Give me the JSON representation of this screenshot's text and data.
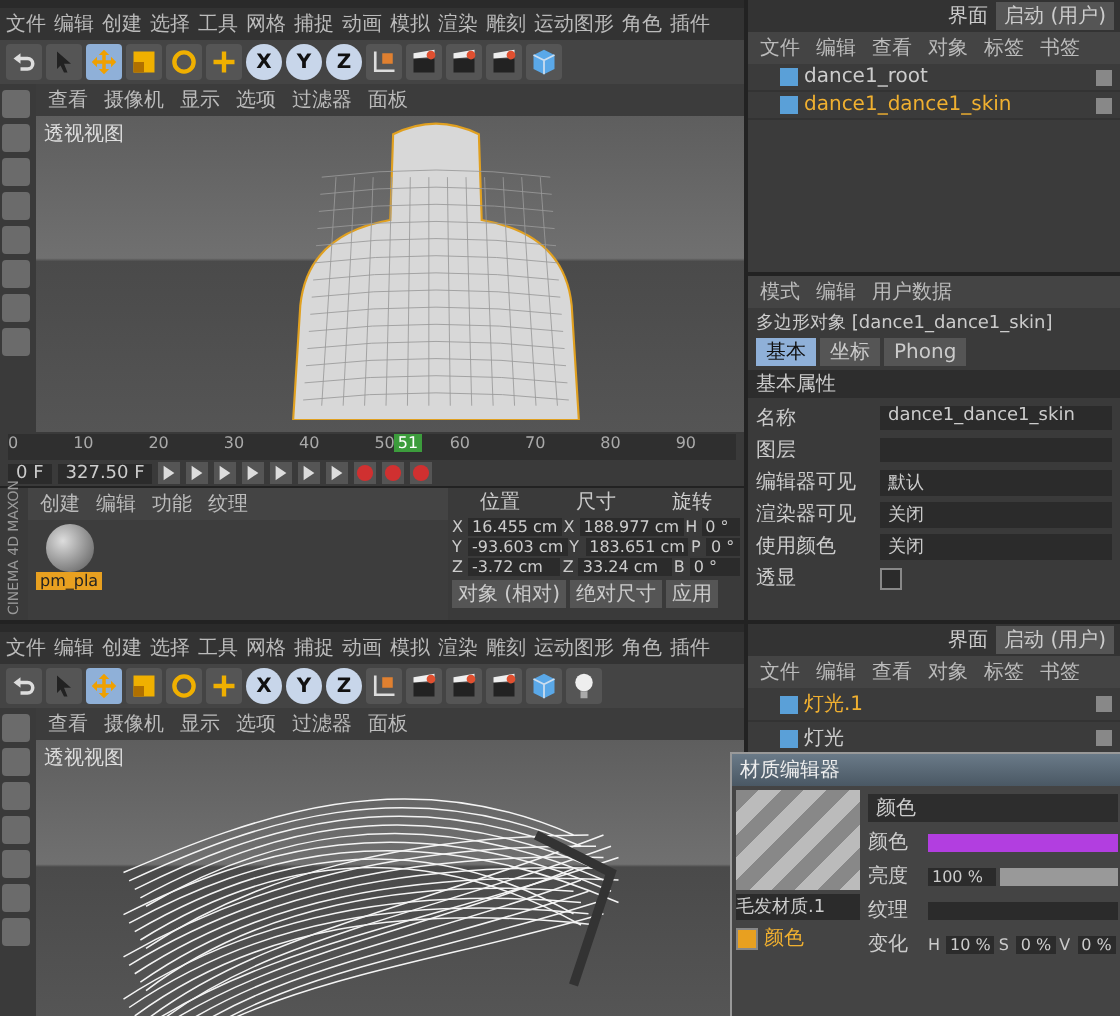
{
  "top_screen": {
    "layout": {
      "label": "界面",
      "value": "启动 (用户)"
    },
    "menu_bar": [
      "文件",
      "编辑",
      "创建",
      "选择",
      "工具",
      "网格",
      "捕捉",
      "动画",
      "模拟",
      "渲染",
      "雕刻",
      "运动图形",
      "角色",
      "插件"
    ],
    "tools": [
      {
        "kind": "undo",
        "selected": false
      },
      {
        "kind": "select",
        "selected": false
      },
      {
        "kind": "move",
        "selected": true
      },
      {
        "kind": "scale",
        "selected": false
      },
      {
        "kind": "rotate",
        "selected": false
      },
      {
        "kind": "add",
        "selected": false
      },
      {
        "kind": "axis",
        "label": "X",
        "selected": true
      },
      {
        "kind": "axis",
        "label": "Y",
        "selected": true
      },
      {
        "kind": "axis",
        "label": "Z",
        "selected": true
      },
      {
        "kind": "coord",
        "selected": false
      },
      {
        "kind": "render",
        "selected": false
      },
      {
        "kind": "render",
        "selected": false
      },
      {
        "kind": "render",
        "selected": false
      },
      {
        "kind": "cube",
        "selected": false
      }
    ],
    "viewport": {
      "menu": [
        "查看",
        "摄像机",
        "显示",
        "选项",
        "过滤器",
        "面板"
      ],
      "label": "透视视图"
    },
    "timeline": {
      "ticks": [
        "0",
        "10",
        "20",
        "30",
        "40",
        "50",
        "60",
        "70",
        "80",
        "90"
      ],
      "current_frame": "51",
      "level": 0.53,
      "start_field": "0 F",
      "end_field": "327.50 F"
    },
    "materials": {
      "menu": [
        "创建",
        "编辑",
        "功能",
        "纹理"
      ],
      "items": [
        {
          "name": "pm_pla",
          "selected": true
        }
      ]
    },
    "brand": {
      "company": "MAXON",
      "product": "CINEMA 4D"
    },
    "coordinates": {
      "headers": [
        "位置",
        "尺寸",
        "旋转"
      ],
      "rows": [
        {
          "axis": "X",
          "position": "16.455 cm",
          "size_axis": "X",
          "size": "188.977 cm",
          "rotation_axis": "H",
          "rotation": "0 °"
        },
        {
          "axis": "Y",
          "position": "-93.603 cm",
          "size_axis": "Y",
          "size": "183.651 cm",
          "rotation_axis": "P",
          "rotation": "0 °"
        },
        {
          "axis": "Z",
          "position": "-3.72 cm",
          "size_axis": "Z",
          "size": "33.24 cm",
          "rotation_axis": "B",
          "rotation": "0 °"
        }
      ],
      "buttons": [
        "对象 (相对)",
        "绝对尺寸",
        "应用"
      ]
    },
    "object_manager": {
      "menu": [
        "文件",
        "编辑",
        "查看",
        "对象",
        "标签",
        "书签"
      ],
      "objects": [
        {
          "name": "dance1_root",
          "selected": false
        },
        {
          "name": "dance1_dance1_skin",
          "selected": true
        }
      ]
    },
    "attributes": {
      "menu": [
        "模式",
        "编辑",
        "用户数据"
      ],
      "title": "多边形对象 [dance1_dance1_skin]",
      "tabs": [
        {
          "label": "基本",
          "selected": true
        },
        {
          "label": "坐标",
          "selected": false
        },
        {
          "label": "Phong",
          "selected": false
        }
      ],
      "section": "基本属性",
      "fields": [
        {
          "kind": "text",
          "label": "名称",
          "value": "dance1_dance1_skin"
        },
        {
          "kind": "text",
          "label": "图层"
        },
        {
          "kind": "select",
          "label": "编辑器可见",
          "value": "默认"
        },
        {
          "kind": "select",
          "label": "渲染器可见",
          "value": "关闭"
        },
        {
          "kind": "select",
          "label": "使用颜色",
          "value": "关闭"
        },
        {
          "kind": "check",
          "label": "透显",
          "checked": false
        }
      ]
    }
  },
  "bottom_screen": {
    "layout": {
      "label": "界面",
      "value": "启动 (用户)"
    },
    "menu_bar": [
      "文件",
      "编辑",
      "创建",
      "选择",
      "工具",
      "网格",
      "捕捉",
      "动画",
      "模拟",
      "渲染",
      "雕刻",
      "运动图形",
      "角色",
      "插件"
    ],
    "tools": [
      {
        "kind": "undo",
        "selected": false
      },
      {
        "kind": "select",
        "selected": false
      },
      {
        "kind": "move",
        "selected": true
      },
      {
        "kind": "scale",
        "selected": false
      },
      {
        "kind": "rotate",
        "selected": false
      },
      {
        "kind": "add",
        "selected": false
      },
      {
        "kind": "axis",
        "label": "X",
        "selected": true
      },
      {
        "kind": "axis",
        "label": "Y",
        "selected": true
      },
      {
        "kind": "axis",
        "label": "Z",
        "selected": true
      },
      {
        "kind": "coord",
        "selected": false
      },
      {
        "kind": "render",
        "selected": false
      },
      {
        "kind": "render",
        "selected": false
      },
      {
        "kind": "render",
        "selected": false
      },
      {
        "kind": "cube",
        "selected": false
      },
      {
        "kind": "light",
        "selected": false
      }
    ],
    "viewport": {
      "menu": [
        "查看",
        "摄像机",
        "显示",
        "选项",
        "过滤器",
        "面板"
      ],
      "label": "透视视图"
    },
    "object_manager": {
      "menu": [
        "文件",
        "编辑",
        "查看",
        "对象",
        "标签",
        "书签"
      ],
      "objects": [
        {
          "name": "灯光.1",
          "selected": true
        },
        {
          "name": "灯光",
          "selected": false
        }
      ]
    },
    "material_editor": {
      "title": "材质编辑器",
      "material_name": "毛发材质.1",
      "channels": [
        {
          "label": "颜色",
          "checked": true,
          "selected": true
        }
      ],
      "section": "颜色",
      "color": {
        "label": "颜色",
        "color": "#b23ee0"
      },
      "brightness": {
        "label": "亮度",
        "value": "100 %",
        "level": 1.0
      },
      "texture": {
        "label": "纹理"
      },
      "hsv": {
        "label": "变化",
        "fields": [
          {
            "label": "H",
            "value": "10 %"
          },
          {
            "label": "S",
            "value": "0 %"
          },
          {
            "label": "V",
            "value": "0 %"
          }
        ]
      }
    }
  }
}
